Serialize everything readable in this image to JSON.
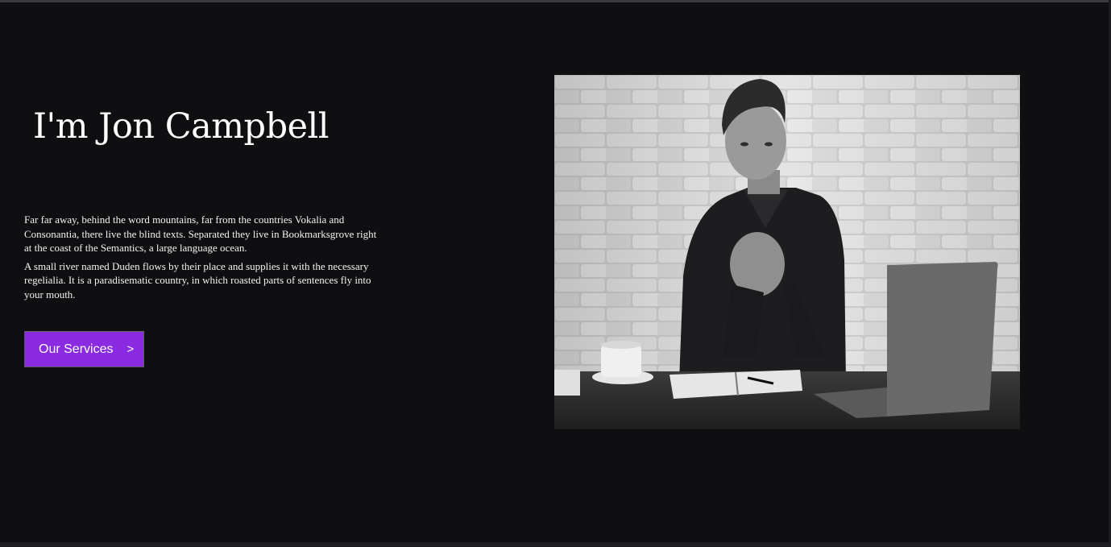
{
  "hero": {
    "title": "I'm Jon Campbell",
    "paragraphs": [
      "Far far away, behind the word mountains, far from the countries Vokalia and Consonantia, there live the blind texts. Separated they live in Bookmarksgrove right at the coast of the Semantics, a large language ocean.",
      "A small river named Duden flows by their place and supplies it with the necessary regelialia. It is a paradisematic country, in which roasted parts of sentences fly into your mouth."
    ],
    "button_label": "Our Services",
    "button_chevron": ">"
  },
  "photo": {
    "subject": "portrait-photo"
  },
  "colors": {
    "background": "#0f0f12",
    "accent": "#8a2be2",
    "text": "#ffffff"
  }
}
